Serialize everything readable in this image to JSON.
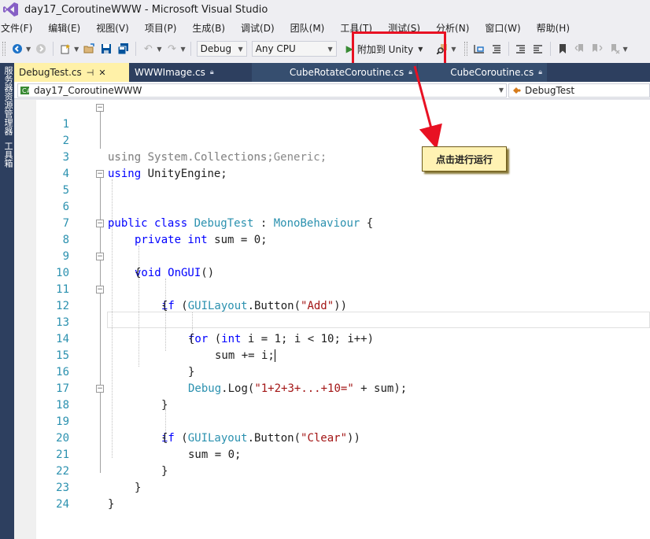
{
  "window": {
    "title": "day17_CoroutineWWW - Microsoft Visual Studio"
  },
  "menu": [
    "文件(F)",
    "编辑(E)",
    "视图(V)",
    "项目(P)",
    "生成(B)",
    "调试(D)",
    "团队(M)",
    "工具(T)",
    "测试(S)",
    "分析(N)",
    "窗口(W)",
    "帮助(H)"
  ],
  "toolbar": {
    "config": "Debug",
    "platform": "Any CPU",
    "attach_label": "附加到 Unity"
  },
  "side_tabs": [
    "服务器资源管理器",
    "工具箱"
  ],
  "tabs": [
    {
      "label": "DebugTest.cs",
      "active": true
    },
    {
      "label": "WWWImage.cs"
    },
    {
      "label": "CubeRotateCoroutine.cs"
    },
    {
      "label": "CubeCoroutine.cs"
    }
  ],
  "nav": {
    "project": "day17_CoroutineWWW",
    "class": "DebugTest"
  },
  "line_numbers": [
    "1",
    "2",
    "3",
    "4",
    "5",
    "6",
    "7",
    "8",
    "9",
    "10",
    "11",
    "12",
    "13",
    "14",
    "15",
    "16",
    "17",
    "18",
    "19",
    "20",
    "21",
    "22",
    "23",
    "24"
  ],
  "code": {
    "l1_kw": "using",
    "l1_rest": " System.Collections;",
    "l2_kw": "using",
    "l2_rest": " System.Collections.Generic;",
    "l3_kw": "using",
    "l3_rest": " UnityEngine;",
    "l5_kw": "public class",
    "l5_cls": "DebugTest",
    "l5_mid": " : ",
    "l5_base": "MonoBehaviour",
    "l5_end": " {",
    "l7_kw": "private int",
    "l7_rest": " sum = 0;",
    "l8_kw": "void",
    "l8_fn": " OnGUI",
    "l8_end": "()",
    "l9": "{",
    "l10_kw": "if",
    "l10_a": " (",
    "l10_ty": "GUILayout",
    "l10_b": ".Button(",
    "l10_st": "\"Add\"",
    "l10_c": "))",
    "l11": "{",
    "l12_kw": "for",
    "l12_a": " (",
    "l12_kw2": "int",
    "l12_b": " i = 1; i < 10; i++)",
    "l13": "{",
    "l14": "sum += i;",
    "l15": "}",
    "l16_ty": "Debug",
    "l16_a": ".Log(",
    "l16_st": "\"1+2+3+...+10=\"",
    "l16_b": " + sum);",
    "l17": "}",
    "l18_kw": "if",
    "l18_a": " (",
    "l18_ty": "GUILayout",
    "l18_b": ".Button(",
    "l18_st": "\"Clear\"",
    "l18_c": "))",
    "l19": "{",
    "l20": "sum = 0;",
    "l21": "}",
    "l22": "}",
    "l23": "}"
  },
  "annotation": {
    "text": "点击进行运行",
    "highlight_color": "#e81123"
  }
}
